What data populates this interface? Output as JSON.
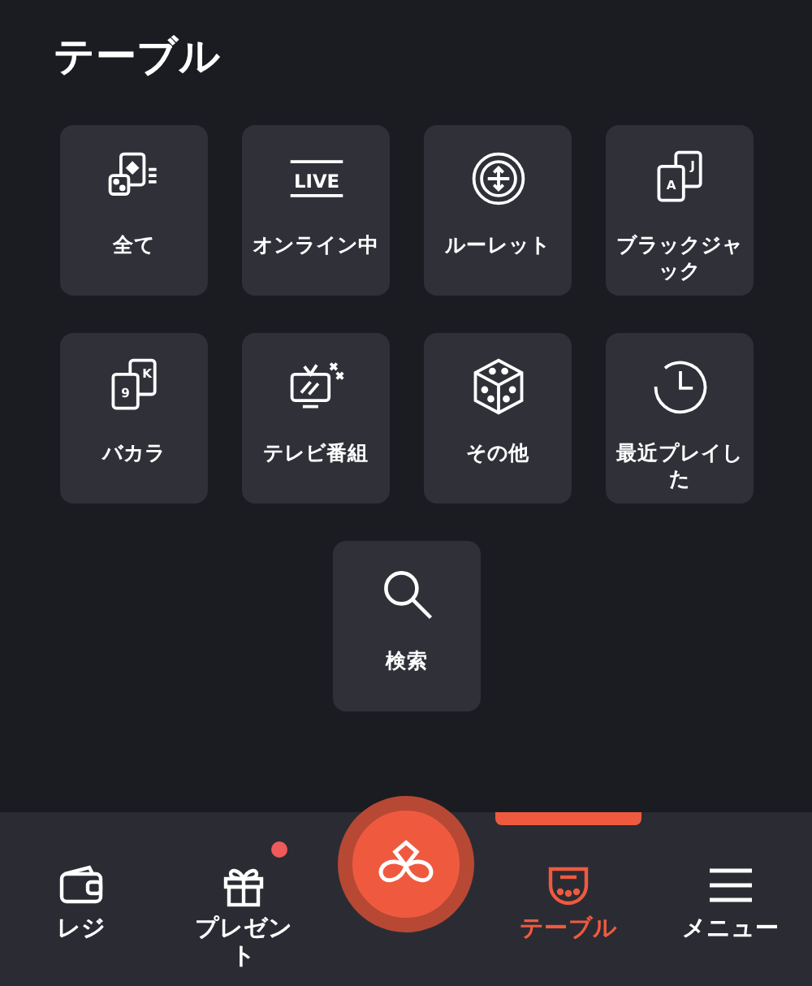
{
  "header": {
    "title": "テーブル"
  },
  "categories": [
    {
      "label": "全て",
      "kind": "all"
    },
    {
      "label": "オンライン中",
      "kind": "live",
      "icon_text": "LIVE"
    },
    {
      "label": "ルーレット",
      "kind": "roulette"
    },
    {
      "label": "ブラックジャック",
      "kind": "cards",
      "card_back": "J",
      "card_front": "A"
    },
    {
      "label": "バカラ",
      "kind": "cards",
      "card_back": "K",
      "card_front": "9"
    },
    {
      "label": "テレビ番組",
      "kind": "tv"
    },
    {
      "label": "その他",
      "kind": "dice"
    },
    {
      "label": "最近プレイした",
      "kind": "clock"
    },
    {
      "label": "検索",
      "kind": "search"
    }
  ],
  "bottom_nav": [
    {
      "label": "レジ",
      "kind": "wallet",
      "selected": false,
      "dot": false
    },
    {
      "label": "プレゼント",
      "kind": "gift",
      "selected": false,
      "dot": true
    },
    {
      "kind": "center",
      "selected": false
    },
    {
      "label": "テーブル",
      "kind": "table",
      "selected": true,
      "dot": false
    },
    {
      "label": "メニュー",
      "kind": "menu",
      "selected": false,
      "dot": false
    }
  ]
}
